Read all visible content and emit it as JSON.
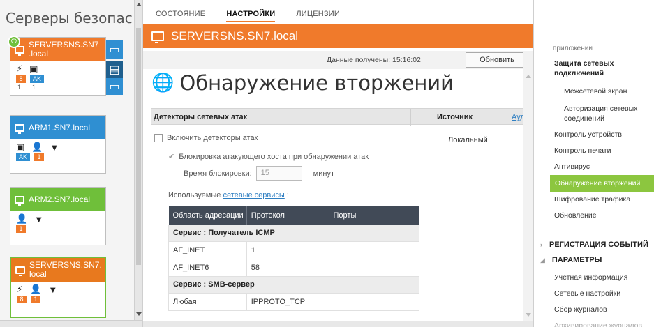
{
  "left_panel": {
    "title": "Серверы безопас",
    "cards": [
      {
        "name_line1": "SERVERSNS.SN7",
        "name_line2": ".local",
        "color": "#f07a2b",
        "icons": [
          "lightning-icon",
          "chip-icon"
        ],
        "badges": [
          {
            "text": "8",
            "color": "#f07a2b"
          },
          {
            "text": "AK",
            "color": "#2f8fd2"
          }
        ],
        "counts": [
          "1",
          "1"
        ]
      },
      {
        "name": "ARM1.SN7.local",
        "color": "#2f8fd2",
        "icons": [
          "chip-icon",
          "user-icon",
          "filter-icon"
        ],
        "badges": [
          {
            "text": "AK",
            "color": "#2f8fd2"
          },
          {
            "text": "1",
            "color": "#f07a2b"
          }
        ]
      },
      {
        "name": "ARM2.SN7.local",
        "color": "#6fbf3a",
        "icons": [
          "user-icon",
          "filter-icon"
        ],
        "badges": [
          {
            "text": "1",
            "color": "#f07a2b"
          }
        ]
      },
      {
        "name_line1": "SERVERSNS.SN7.",
        "name_line2": "local",
        "color": "#e8791e",
        "icons": [
          "lightning-icon",
          "user-icon",
          "filter-icon"
        ],
        "badges": [
          {
            "text": "8",
            "color": "#f07a2b"
          },
          {
            "text": "1",
            "color": "#f07a2b"
          }
        ]
      }
    ]
  },
  "tabs": [
    {
      "label": "СОСТОЯНИЕ",
      "active": false
    },
    {
      "label": "НАСТРОЙКИ",
      "active": true
    },
    {
      "label": "ЛИЦЕНЗИИ",
      "active": false
    }
  ],
  "banner": {
    "title": "SERVERSNS.SN7.local",
    "color": "#f07a2b"
  },
  "status": {
    "data_label": "Данные получены: 15:16:02",
    "refresh_label": "Обновить"
  },
  "page": {
    "title": "Обнаружение вторжений"
  },
  "grid": {
    "col1": "Детекторы сетевых атак",
    "col2": "Источник",
    "col3": "Ауд"
  },
  "settings": {
    "enable_label": "Включить детекторы атак",
    "source_value": "Локальный",
    "block_label": "Блокировка атакующего хоста при обнаружении атак",
    "block_time_label": "Время блокировки:",
    "block_time_value": "15",
    "block_time_unit": "минут",
    "services_prefix": "Используемые",
    "services_link": "сетевые сервисы",
    "services_suffix": ":"
  },
  "protocol_table": {
    "headers": [
      "Область адресации",
      "Протокол",
      "Порты"
    ],
    "groups": [
      {
        "title": "Сервис : Получатель ICMP",
        "rows": [
          [
            "AF_INET",
            "1",
            ""
          ],
          [
            "AF_INET6",
            "58",
            ""
          ]
        ]
      },
      {
        "title": "Сервис : SMB-сервер",
        "rows": [
          [
            "Любая",
            "IPPROTO_TCP",
            ""
          ]
        ]
      }
    ]
  },
  "right_nav": {
    "clipped_top": "приложении",
    "items": [
      {
        "label_line1": "Защита сетевых",
        "label_line2": "подключений",
        "style": "bold"
      },
      {
        "label": "Межсетевой экран",
        "style": "sub"
      },
      {
        "label_line1": "Авторизация сетевых",
        "label_line2": "соединений",
        "style": "sub"
      },
      {
        "label": "Контроль устройств",
        "style": "normal"
      },
      {
        "label": "Контроль печати",
        "style": "normal"
      },
      {
        "label": "Антивирус",
        "style": "normal"
      },
      {
        "label": "Обнаружение вторжений",
        "style": "active"
      },
      {
        "label": "Шифрование трафика",
        "style": "normal"
      },
      {
        "label": "Обновление",
        "style": "normal"
      }
    ],
    "sections": [
      {
        "label": "РЕГИСТРАЦИЯ СОБЫТИЙ",
        "expanded": false
      },
      {
        "label": "ПАРАМЕТРЫ",
        "expanded": true
      }
    ],
    "params_items": [
      "Учетная информация",
      "Сетевые настройки",
      "Сбор журналов",
      "Архивирование журналов"
    ]
  },
  "colors": {
    "accent": "#f07a2b",
    "active_nav": "#8cc63f",
    "table_header": "#414a57",
    "link": "#2f7fc2"
  }
}
